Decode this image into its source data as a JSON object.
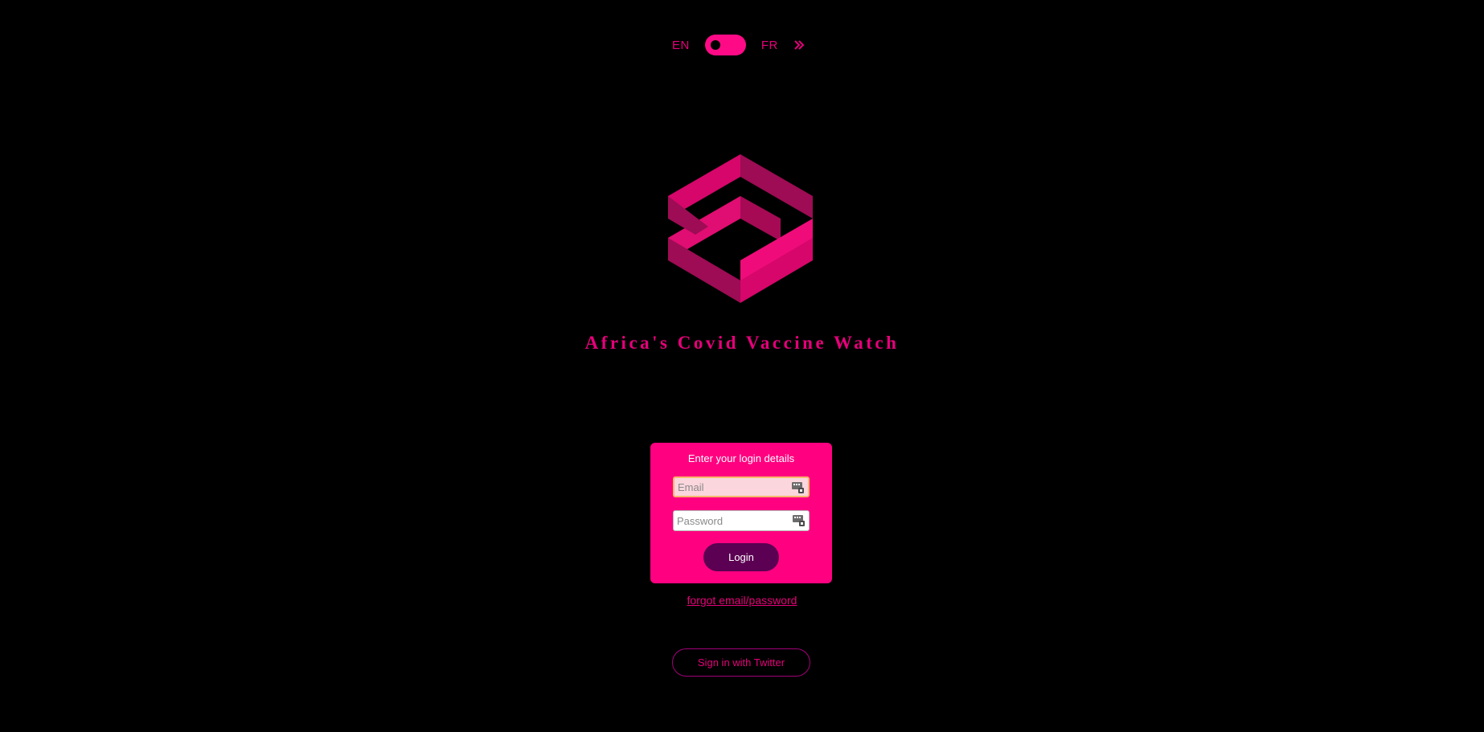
{
  "language_switch": {
    "left_label": "EN",
    "right_label": "FR"
  },
  "brand": {
    "title": "Africa's Covid Vaccine Watch"
  },
  "login_card": {
    "heading": "Enter your login details",
    "email_placeholder": "Email",
    "password_placeholder": "Password",
    "login_label": "Login"
  },
  "forgot_link": "forgot email/password",
  "twitter_button": "Sign in with Twitter",
  "colors": {
    "background": "#000000",
    "accent": "#ff0080",
    "brand_text": "#e5007a",
    "login_button": "#5b0052"
  },
  "icons": {
    "lang_forward": "double-chevron-right-icon",
    "autofill": "autofill-key-icon",
    "logo": "interlocked-hexagon-logo"
  }
}
